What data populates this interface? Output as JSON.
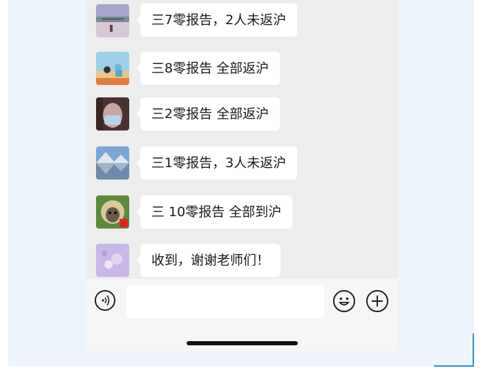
{
  "messages": [
    {
      "text": "三7零报告，2人未返沪",
      "avatar": "landscape-avatar"
    },
    {
      "text": "三8零报告 全部返沪",
      "avatar": "beach-avatar"
    },
    {
      "text": "三2零报告 全部返沪",
      "avatar": "masked-girl-avatar"
    },
    {
      "text": "三1零报告，3人未返沪",
      "avatar": "mountain-lake-avatar"
    },
    {
      "text": "三 10零报告 全部到沪",
      "avatar": "cat-avatar"
    },
    {
      "text": "收到，谢谢老师们！",
      "avatar": "flower-avatar"
    }
  ],
  "input": {
    "placeholder": ""
  },
  "colors": {
    "chat_bg": "#ededed",
    "bubble": "#ffffff",
    "accent": "#2a8be0"
  },
  "icons": {
    "voice": "voice-icon",
    "emoji": "emoji-icon",
    "plus": "plus-icon"
  }
}
